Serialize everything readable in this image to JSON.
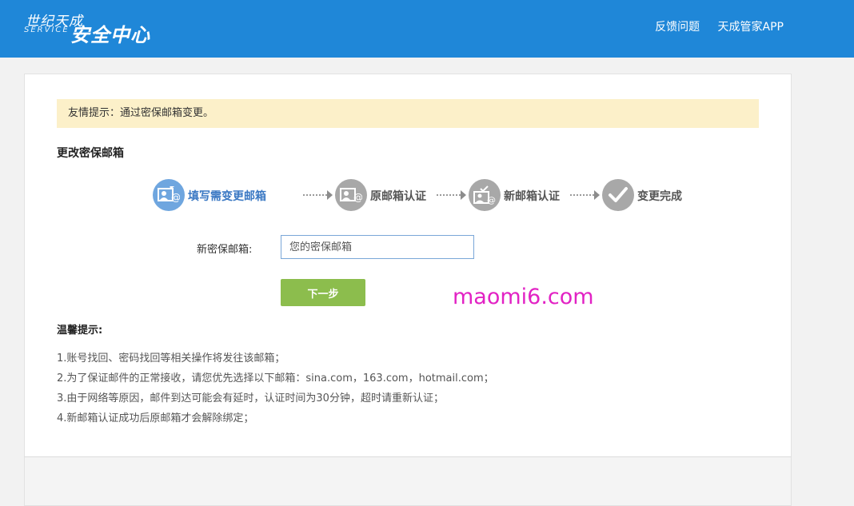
{
  "header": {
    "logo_line1": "世纪天成",
    "logo_line2": "SERVICE",
    "logo_line3": "安全中心",
    "nav": [
      "反馈问题",
      "天成管家APP"
    ]
  },
  "tip": "友情提示：通过密保邮箱变更。",
  "section_title": "更改密保邮箱",
  "steps": [
    {
      "label": "填写需变更邮箱",
      "icon": "id-card-email-icon",
      "active": true
    },
    {
      "label": "原邮箱认证",
      "icon": "id-card-email-icon",
      "active": false
    },
    {
      "label": "新邮箱认证",
      "icon": "id-card-check-icon",
      "active": false
    },
    {
      "label": "变更完成",
      "icon": "checkmark-icon",
      "active": false
    }
  ],
  "form": {
    "label": "新密保邮箱:",
    "placeholder": "您的密保邮箱",
    "next_button": "下一步"
  },
  "watermark": "maomi6.com",
  "warm_tips": {
    "title": "温馨提示:",
    "items": [
      "1.账号找回、密码找回等相关操作将发往该邮箱；",
      "2.为了保证邮件的正常接收，请您优先选择以下邮箱：sina.com，163.com，hotmail.com；",
      "3.由于网络等原因，邮件到达可能会有延时，认证时间为30分钟，超时请重新认证；",
      "4.新邮箱认证成功后原邮箱才会解除绑定；"
    ]
  },
  "colors": {
    "header_bg": "#1f87d8",
    "tip_bg": "#fcf0c9",
    "button_bg": "#8cbd4d",
    "active_step": "#6fa6df",
    "inactive_step": "#a8a8a8"
  }
}
